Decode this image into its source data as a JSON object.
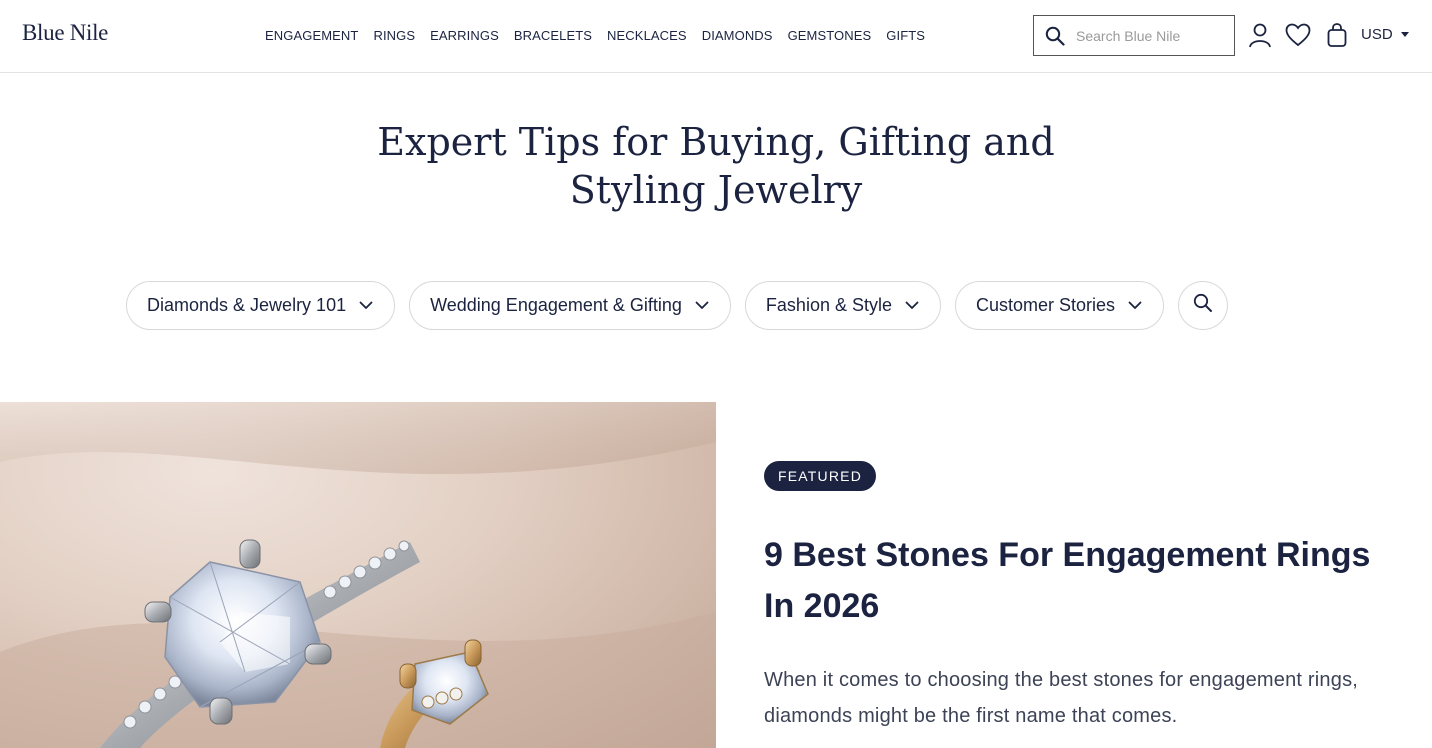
{
  "header": {
    "logo": "Blue Nile",
    "nav": [
      "ENGAGEMENT",
      "RINGS",
      "EARRINGS",
      "BRACELETS",
      "NECKLACES",
      "DIAMONDS",
      "GEMSTONES",
      "GIFTS"
    ],
    "search_placeholder": "Search Blue Nile",
    "currency": "USD",
    "icons": {
      "search": "search-icon",
      "account": "user-icon",
      "wishlist": "heart-icon",
      "bag": "shopping-bag-icon"
    }
  },
  "title": "Expert Tips for Buying, Gifting and Styling Jewelry",
  "filters": [
    {
      "label": "Diamonds & Jewelry 101"
    },
    {
      "label": "Wedding Engagement & Gifting"
    },
    {
      "label": "Fashion & Style"
    },
    {
      "label": "Customer Stories"
    }
  ],
  "featured": {
    "badge": "FEATURED",
    "title": "9 Best Stones For Engagement Rings In 2026",
    "excerpt": "When it comes to choosing the best stones for engagement rings, diamonds might be the first name that comes."
  },
  "colors": {
    "brand": "#1b2340",
    "background": "#ffffff",
    "border": "#d8d8d8"
  }
}
